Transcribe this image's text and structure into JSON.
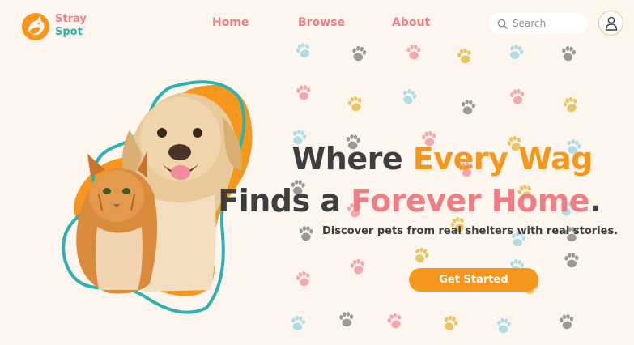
{
  "brand": {
    "name_line1": "Stray",
    "name_line2": "Spot",
    "logo_icon": "cat-dog-logo-icon"
  },
  "nav": {
    "home": "Home",
    "browse": "Browse",
    "about": "About"
  },
  "search": {
    "placeholder": "Search",
    "value": ""
  },
  "hero": {
    "headline_line1_a": "Where ",
    "headline_line1_b": "Every Wag",
    "headline_line2_a": "Finds a ",
    "headline_line2_b": "Forever Home",
    "headline_line2_c": ".",
    "subtitle": "Discover pets from real shelters with real stories.",
    "cta_label": "Get Started"
  },
  "colors": {
    "background": "#fdf6ee",
    "brand_orange": "#f7961d",
    "brand_pink": "#ee7d84",
    "brand_teal": "#2fb2ad",
    "text_dark": "#3e3e3e"
  }
}
